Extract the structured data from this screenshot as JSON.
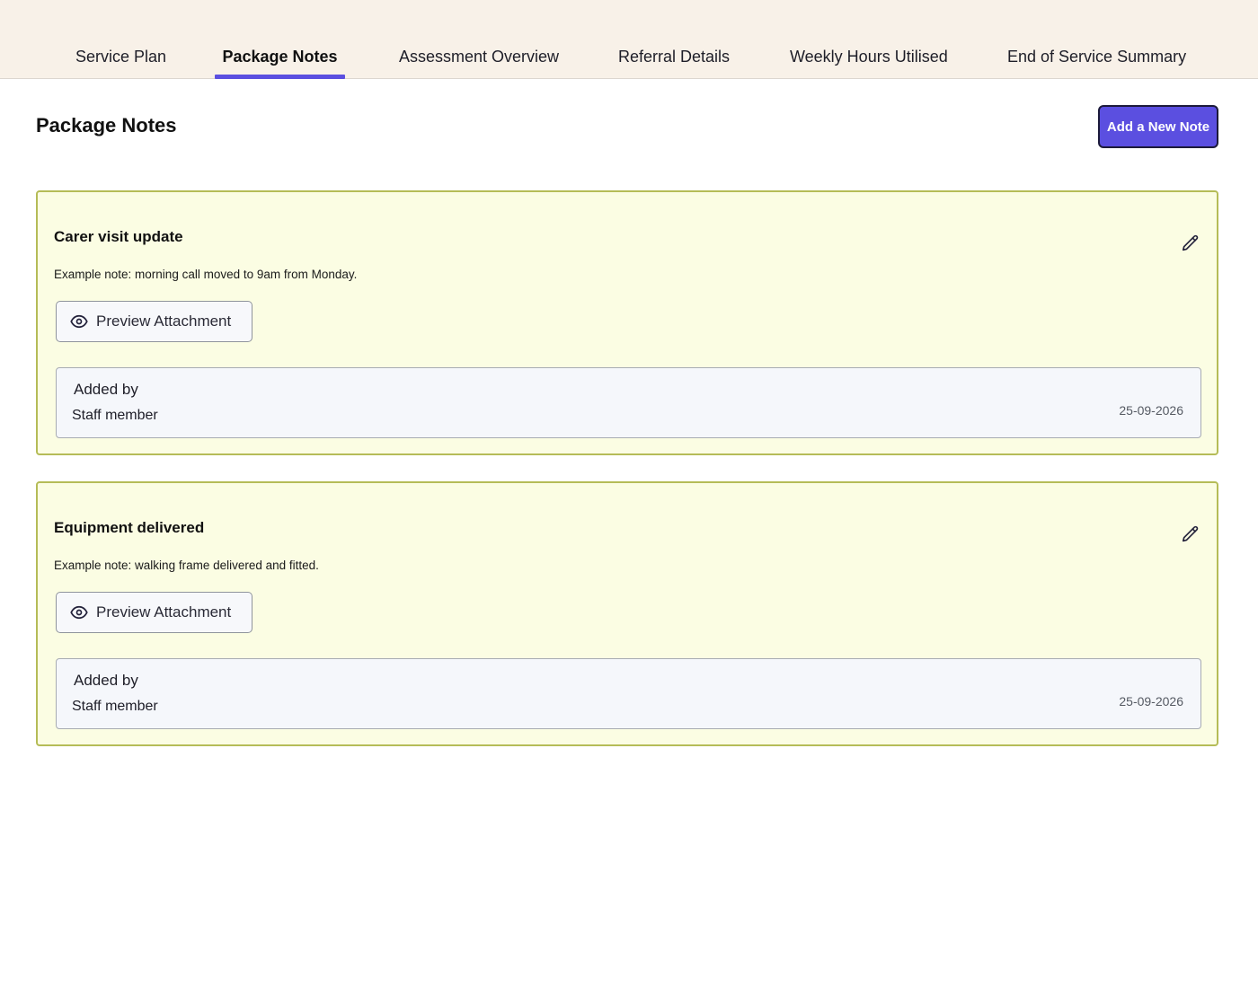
{
  "tabs": [
    {
      "label": "Service Plan",
      "active": false
    },
    {
      "label": "Package Notes",
      "active": true
    },
    {
      "label": "Assessment Overview",
      "active": false
    },
    {
      "label": "Referral Details",
      "active": false
    },
    {
      "label": "Weekly Hours Utilised",
      "active": false
    },
    {
      "label": "End of Service Summary",
      "active": false
    }
  ],
  "header": {
    "title": "Package Notes",
    "add_button_label": "Add a New Note"
  },
  "notes": [
    {
      "title": "Carer visit update",
      "body": "Example note: morning call moved to 9am from Monday.",
      "preview_label": "Preview Attachment",
      "added_by_label": "Added by",
      "author": "Staff member",
      "date": "25-09-2026"
    },
    {
      "title": "Equipment delivered",
      "body": "Example note: walking frame delivered and fitted.",
      "preview_label": "Preview Attachment",
      "added_by_label": "Added by",
      "author": "Staff member",
      "date": "25-09-2026"
    }
  ],
  "colors": {
    "accent": "#5b4fe0",
    "tabbar_bg": "#f8f1e8",
    "note_bg": "#fbfde3",
    "note_border": "#b5bc57"
  },
  "icons": {
    "edit": "pencil-icon",
    "preview": "eye-icon"
  }
}
